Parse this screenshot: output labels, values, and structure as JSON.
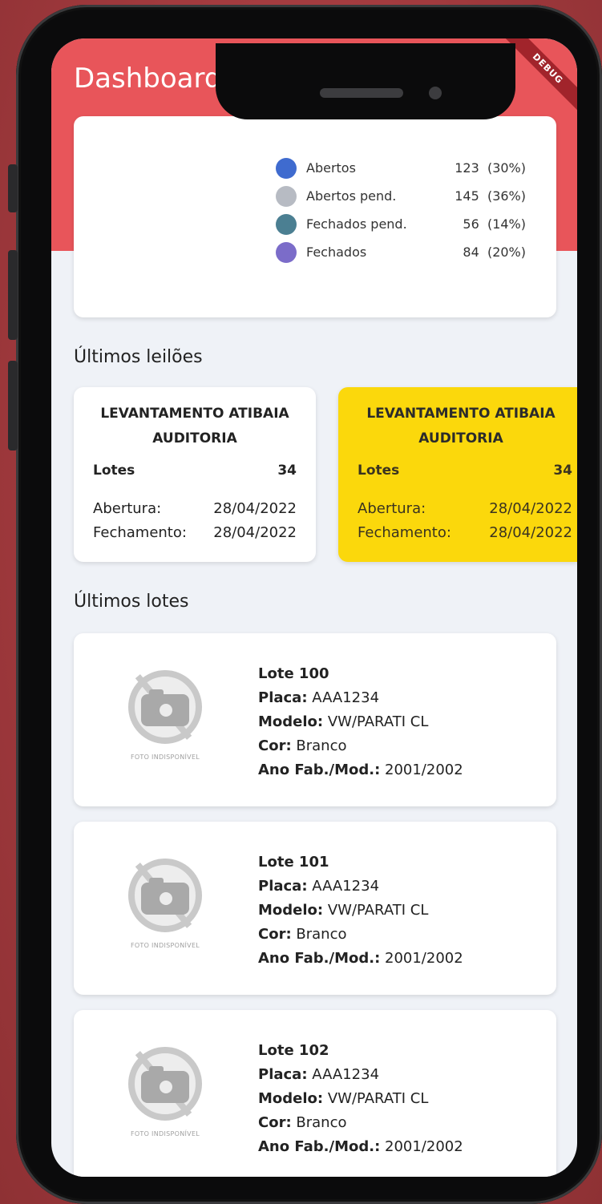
{
  "app": {
    "title": "Dashboard",
    "debug_banner": "DEBUG"
  },
  "chart": {
    "legend": [
      {
        "label": "Abertos",
        "value": "123",
        "percent": "(30%)",
        "color": "#3f6bcf"
      },
      {
        "label": "Abertos pend.",
        "value": "145",
        "percent": "(36%)",
        "color": "#b7bbc3"
      },
      {
        "label": "Fechados pend.",
        "value": "56",
        "percent": "(14%)",
        "color": "#4b7f92"
      },
      {
        "label": "Fechados",
        "value": "84",
        "percent": "(20%)",
        "color": "#7b6cc9"
      }
    ]
  },
  "sections": {
    "auctions_title": "Últimos leilões",
    "lots_title": "Últimos lotes"
  },
  "auctions": [
    {
      "title": "LEVANTAMENTO ATIBAIA AUDITORIA",
      "lots_label": "Lotes",
      "lots_value": "34",
      "open_label": "Abertura:",
      "open_value": "28/04/2022",
      "close_label": "Fechamento:",
      "close_value": "28/04/2022"
    },
    {
      "title": "LEVANTAMENTO ATIBAIA AUDITORIA",
      "lots_label": "Lotes",
      "lots_value": "34",
      "open_label": "Abertura:",
      "open_value": "28/04/2022",
      "close_label": "Fechamento:",
      "close_value": "28/04/2022"
    }
  ],
  "lots": [
    {
      "name": "Lote 100",
      "plate_label": "Placa:",
      "plate": "AAA1234",
      "model_label": "Modelo:",
      "model": "VW/PARATI CL",
      "color_label": "Cor:",
      "color": "Branco",
      "year_label": "Ano Fab./Mod.:",
      "year": "2001/2002",
      "photo_caption": "FOTO INDISPONÍVEL"
    },
    {
      "name": "Lote 101",
      "plate_label": "Placa:",
      "plate": "AAA1234",
      "model_label": "Modelo:",
      "model": "VW/PARATI CL",
      "color_label": "Cor:",
      "color": "Branco",
      "year_label": "Ano Fab./Mod.:",
      "year": "2001/2002",
      "photo_caption": "FOTO INDISPONÍVEL"
    },
    {
      "name": "Lote 102",
      "plate_label": "Placa:",
      "plate": "AAA1234",
      "model_label": "Modelo:",
      "model": "VW/PARATI CL",
      "color_label": "Cor:",
      "color": "Branco",
      "year_label": "Ano Fab./Mod.:",
      "year": "2001/2002",
      "photo_caption": "FOTO INDISPONÍVEL"
    }
  ]
}
